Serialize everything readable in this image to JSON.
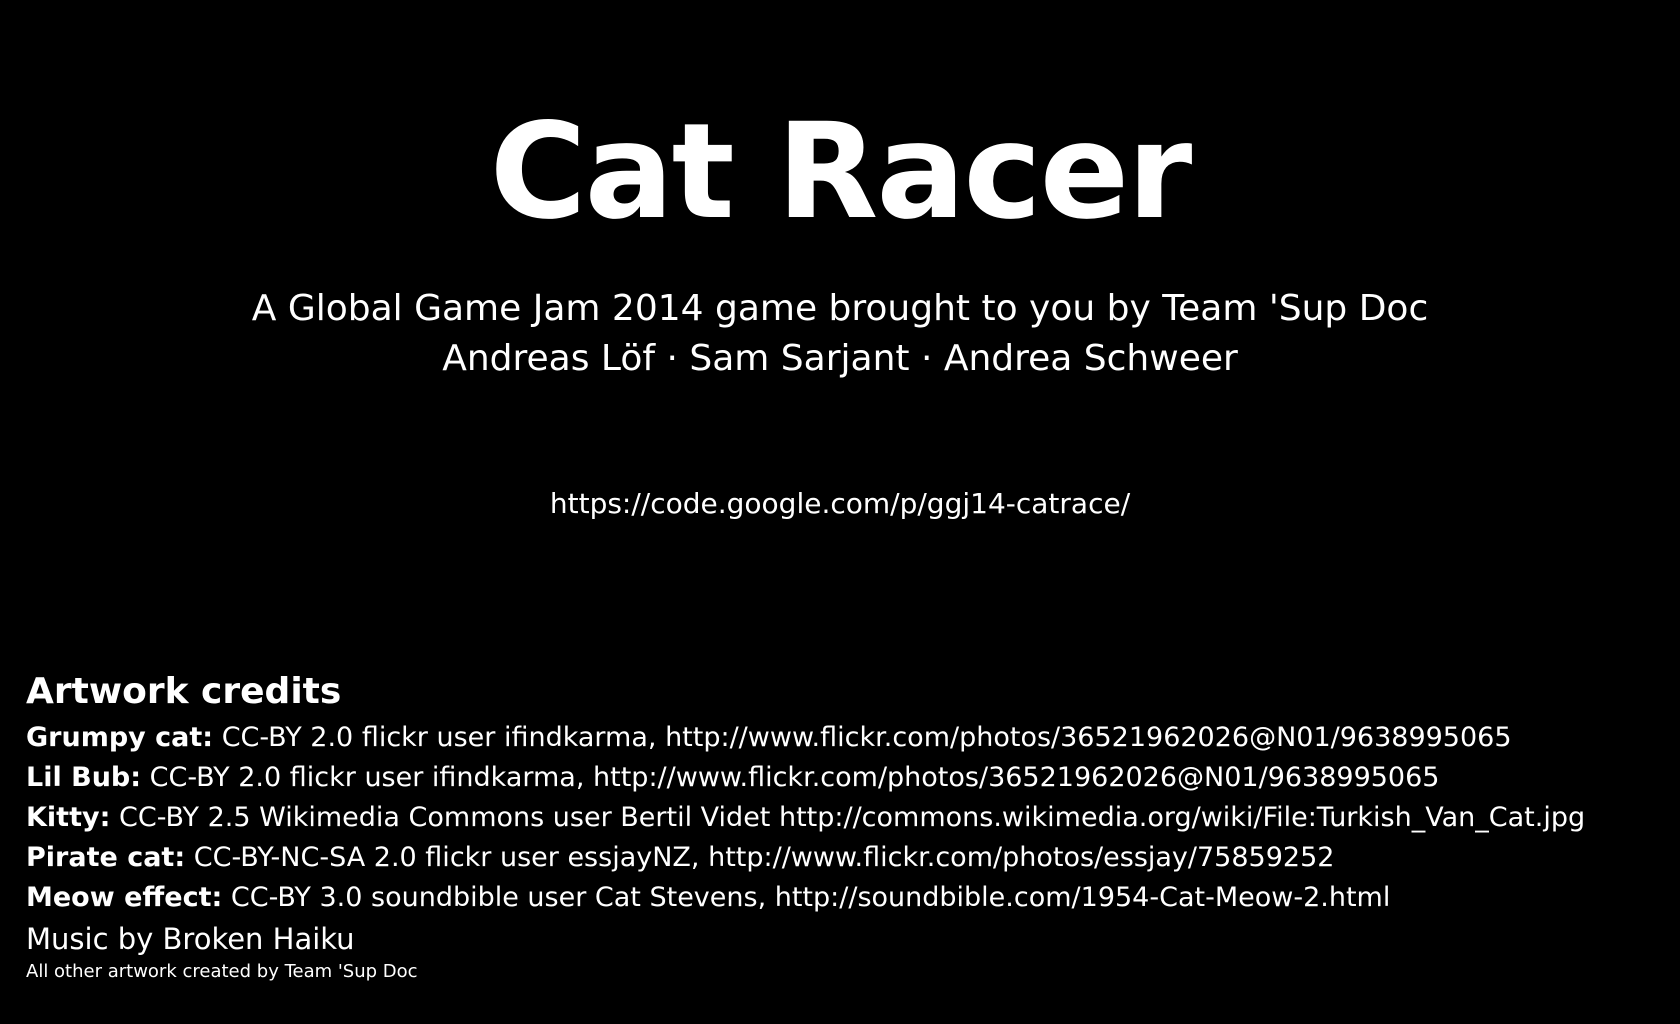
{
  "title": "Cat Racer",
  "subtitle": "A Global Game Jam 2014 game brought to you by Team 'Sup Doc",
  "authors": "Andreas Löf · Sam Sarjant · Andrea Schweer",
  "url": "https://code.google.com/p/ggj14-catrace/",
  "credits": {
    "heading": "Artwork credits",
    "items": [
      {
        "name": "Grumpy cat:",
        "text": "CC-BY 2.0 flickr user ifindkarma, http://www.flickr.com/photos/36521962026@N01/9638995065"
      },
      {
        "name": "Lil Bub:",
        "text": "CC-BY 2.0 flickr user ifindkarma, http://www.flickr.com/photos/36521962026@N01/9638995065"
      },
      {
        "name": "Kitty:",
        "text": "CC-BY 2.5 Wikimedia Commons user Bertil Videt http://commons.wikimedia.org/wiki/File:Turkish_Van_Cat.jpg"
      },
      {
        "name": "Pirate cat:",
        "text": "CC-BY-NC-SA 2.0 flickr user essjayNZ, http://www.flickr.com/photos/essjay/75859252"
      },
      {
        "name": "Meow effect:",
        "text": "CC-BY 3.0 soundbible user Cat Stevens, http://soundbible.com/1954-Cat-Meow-2.html"
      }
    ],
    "music": "Music by Broken Haiku",
    "other": "All other artwork created by Team 'Sup Doc"
  },
  "colors": {
    "background": "#000000",
    "text": "#ffffff"
  }
}
